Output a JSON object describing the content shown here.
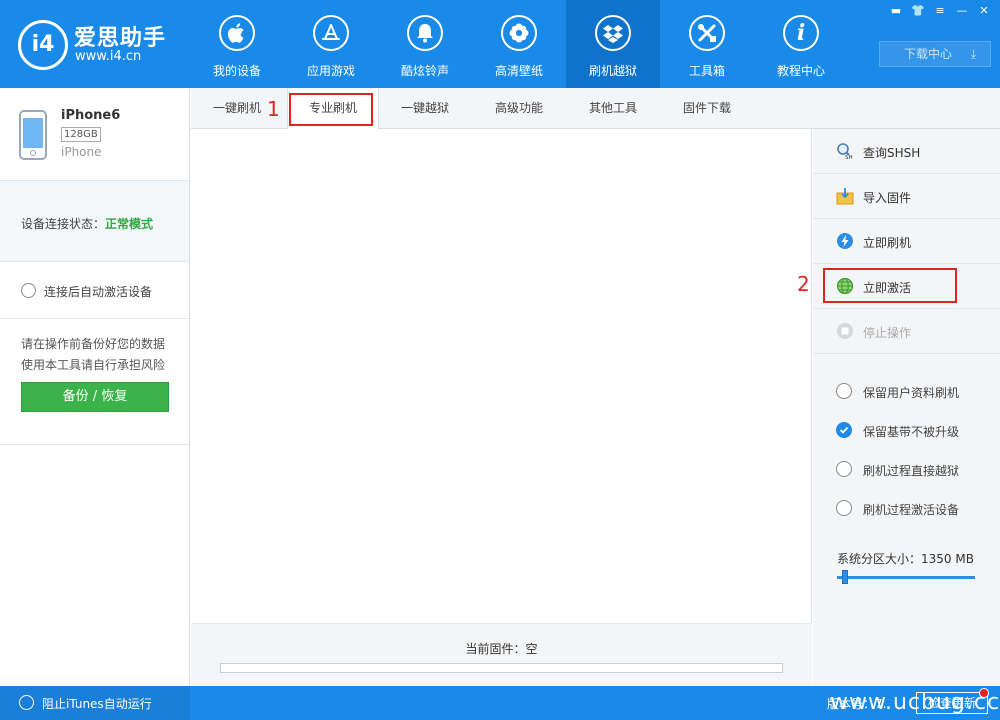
{
  "app": {
    "logo_badge": "i4",
    "logo_name": "爱思助手",
    "logo_url": "www.i4.cn"
  },
  "nav": {
    "items": [
      {
        "label": "我的设备",
        "icon": "apple-icon"
      },
      {
        "label": "应用游戏",
        "icon": "app-store-icon"
      },
      {
        "label": "酷炫铃声",
        "icon": "bell-icon"
      },
      {
        "label": "高清壁纸",
        "icon": "flower-icon"
      },
      {
        "label": "刷机越狱",
        "icon": "dropbox-box-icon"
      },
      {
        "label": "工具箱",
        "icon": "tools-icon"
      },
      {
        "label": "教程中心",
        "icon": "info-icon"
      }
    ],
    "active_index": 4
  },
  "window_controls": [
    "▬",
    "👕",
    "≡",
    "—",
    "✕"
  ],
  "download_center": "下载中心",
  "device": {
    "name": "iPhone6",
    "capacity": "128GB",
    "type": "iPhone"
  },
  "status": {
    "label": "设备连接状态：",
    "value": "正常模式"
  },
  "auto_activate_label": "连接后自动激活设备",
  "warning": {
    "line1": "请在操作前备份好您的数据",
    "line2": "使用本工具请自行承担风险"
  },
  "backup_button": "备份 / 恢复",
  "tabs": [
    "一键刷机",
    "专业刷机",
    "一键越狱",
    "高级功能",
    "其他工具",
    "固件下载"
  ],
  "active_tab": 1,
  "annotations": {
    "a1": "1",
    "a2": "2"
  },
  "current_firmware": "当前固件：空",
  "actions": {
    "query_shsh": "查询SHSH",
    "import_firmware": "导入固件",
    "flash_now": "立即刷机",
    "activate_now": "立即激活",
    "stop": "停止操作"
  },
  "options": {
    "keep_user_data": "保留用户资料刷机",
    "keep_baseband": "保留基带不被升级",
    "jailbreak_during": "刷机过程直接越狱",
    "activate_during": "刷机过程激活设备"
  },
  "system_partition": "系统分区大小：1350 MB",
  "statusbar": {
    "block_itunes": "阻止iTunes自动运行",
    "version": "版本号：7.",
    "check_update": "检查更新"
  },
  "watermark": "www.ucbug.cc",
  "colors": {
    "brand_blue": "#1a8ae8",
    "active_nav": "#0f73cc",
    "success_green": "#2ea83f",
    "backup_green": "#3cb34a",
    "annotation_red": "#e02424"
  }
}
